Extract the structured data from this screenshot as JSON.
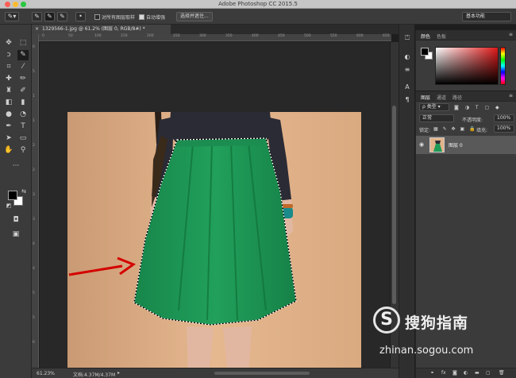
{
  "window": {
    "title": "Adobe Photoshop CC 2015.5"
  },
  "options_bar": {
    "sample_all_layers_label": "对所有图层取样",
    "sample_all_layers_checked": false,
    "auto_enhance_label": "自动增强",
    "auto_enhance_checked": true,
    "select_and_mask_label": "选择并遮住...",
    "workspace_value": "基本功能"
  },
  "document": {
    "tab_label": "1329566-1.jpg @ 61.2% (图层 0, RGB/8#) *",
    "ruler_top_labels": [
      "0",
      "50",
      "100",
      "150",
      "200",
      "250",
      "300",
      "350",
      "400",
      "450",
      "500",
      "550",
      "600",
      "650"
    ],
    "ruler_left_labels": [
      "0",
      "5",
      "1 0 0",
      "1 5 0",
      "2 0 0",
      "2 5 0",
      "3 0 0",
      "3 5 0",
      "4 0 0",
      "4 5 0",
      "5 0 0",
      "5 5 0",
      "6 0 0"
    ]
  },
  "status": {
    "zoom": "61.23%",
    "doc_size": "文档:4.37M/4.37M"
  },
  "color_panel": {
    "tabs": [
      "颜色",
      "色板"
    ],
    "active_tab": "颜色",
    "foreground": "#000000",
    "background": "#ffffff",
    "hue_color": "#e01818"
  },
  "layers_panel": {
    "tabs": [
      "图层",
      "通道",
      "路径"
    ],
    "active_tab": "图层",
    "filter_kind": "类型",
    "blend_mode": "正常",
    "opacity_label": "不透明度:",
    "opacity_value": "100%",
    "lock_label": "锁定:",
    "fill_label": "填充:",
    "fill_value": "100%",
    "layers": [
      {
        "name": "图层 0",
        "visible": true
      }
    ],
    "footer_icons": [
      "link-icon",
      "fx-icon",
      "mask-icon",
      "adjustment-icon",
      "folder-icon",
      "new-layer-icon",
      "trash-icon"
    ],
    "fx_label": "fx"
  },
  "watermark": {
    "logo_letter": "S",
    "brand_text": "搜狗指南",
    "url": "zhinan.sogou.com"
  },
  "colors": {
    "skirt": "#1f9a57",
    "photo_background": "#e0b288",
    "sweater": "#2b2b35",
    "arrow": "#d40000",
    "panel_bg": "#3b3b3b"
  }
}
